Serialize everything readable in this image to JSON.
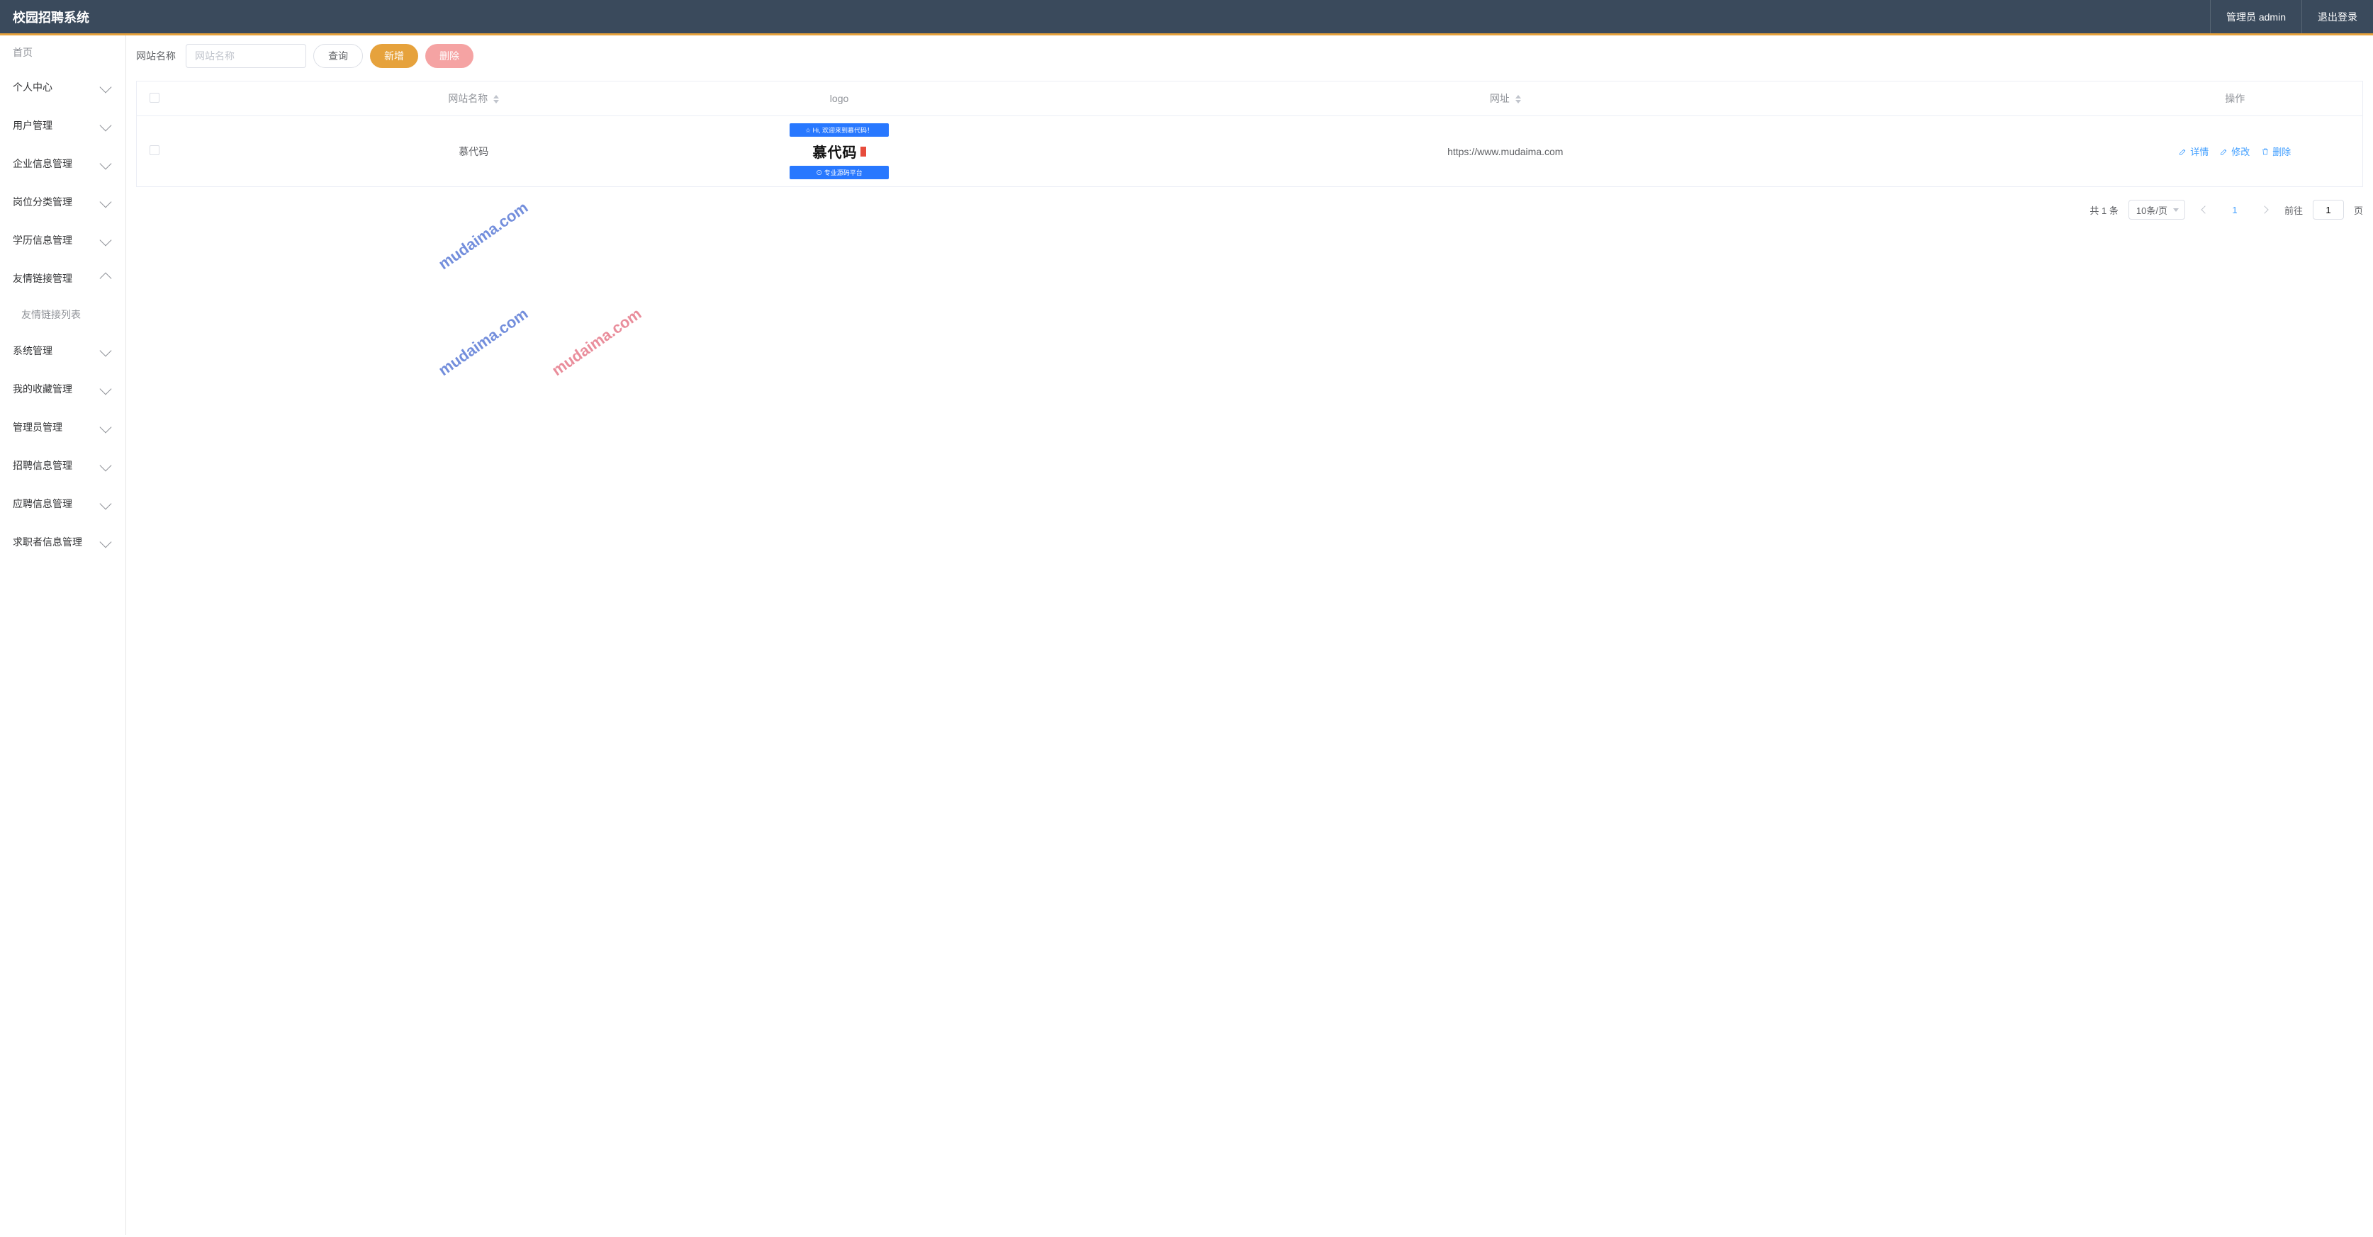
{
  "header": {
    "title": "校园招聘系统",
    "admin_label": "管理员 admin",
    "logout_label": "退出登录"
  },
  "sidebar": {
    "home": "首页",
    "items": [
      {
        "label": "个人中心",
        "expanded": false
      },
      {
        "label": "用户管理",
        "expanded": false
      },
      {
        "label": "企业信息管理",
        "expanded": false
      },
      {
        "label": "岗位分类管理",
        "expanded": false
      },
      {
        "label": "学历信息管理",
        "expanded": false
      },
      {
        "label": "友情链接管理",
        "expanded": true,
        "children": [
          "友情链接列表"
        ]
      },
      {
        "label": "系统管理",
        "expanded": false
      },
      {
        "label": "我的收藏管理",
        "expanded": false
      },
      {
        "label": "管理员管理",
        "expanded": false
      },
      {
        "label": "招聘信息管理",
        "expanded": false
      },
      {
        "label": "应聘信息管理",
        "expanded": false
      },
      {
        "label": "求职者信息管理",
        "expanded": false
      }
    ]
  },
  "toolbar": {
    "search_label": "网站名称",
    "search_placeholder": "网站名称",
    "query_label": "查询",
    "add_label": "新增",
    "delete_label": "删除"
  },
  "table": {
    "columns": {
      "name": "网站名称",
      "logo": "logo",
      "url": "网址",
      "ops": "操作"
    },
    "rows": [
      {
        "name": "慕代码",
        "logo": {
          "top_bar": "☆ Hi, 欢迎来到慕代码！",
          "main_text": "慕代码",
          "bottom_bar": "⊙ 专业源码平台"
        },
        "url": "https://www.mudaima.com"
      }
    ],
    "actions": {
      "detail": "详情",
      "edit": "修改",
      "delete": "删除"
    }
  },
  "pagination": {
    "total_text": "共 1 条",
    "per_page": "10条/页",
    "current_page": "1",
    "goto_label": "前往",
    "goto_value": "1",
    "page_suffix": "页"
  },
  "watermark": "mudaima.com"
}
